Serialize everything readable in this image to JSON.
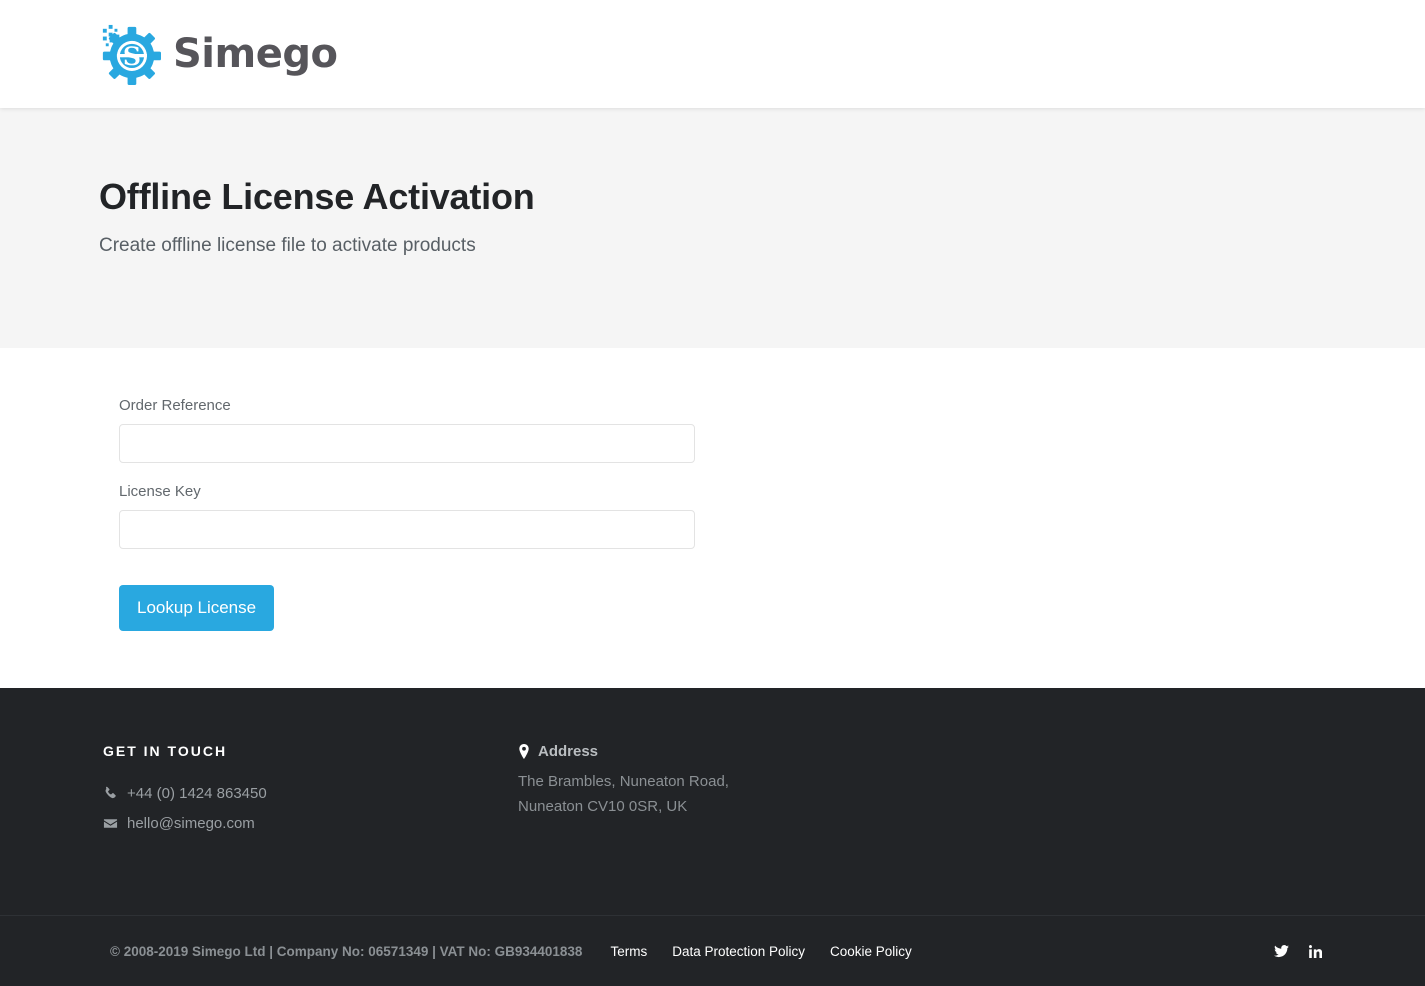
{
  "header": {
    "logo_text": "Simego",
    "logo_icon": "simego-gear-logo"
  },
  "hero": {
    "title": "Offline License Activation",
    "subtitle": "Create offline license file to activate products"
  },
  "form": {
    "order_reference": {
      "label": "Order Reference",
      "value": "",
      "placeholder": ""
    },
    "license_key": {
      "label": "License Key",
      "value": "",
      "placeholder": ""
    },
    "submit_label": "Lookup License",
    "accent_color": "#29a8e0"
  },
  "footer": {
    "background_color": "#222427",
    "get_in_touch": {
      "heading": "GET IN TOUCH",
      "phone": "+44 (0) 1424 863450",
      "phone_icon": "phone-icon",
      "email": "hello@simego.com",
      "email_icon": "envelope-icon"
    },
    "address": {
      "title": "Address",
      "title_icon": "map-pin-icon",
      "line1": "The Brambles, Nuneaton Road,",
      "line2": "Nuneaton CV10 0SR, UK"
    },
    "bottom": {
      "copyright": "© 2008-2019 Simego Ltd | Company No: 06571349 | VAT No: GB934401838",
      "links": [
        {
          "label": "Terms"
        },
        {
          "label": "Data Protection Policy"
        },
        {
          "label": "Cookie Policy"
        }
      ],
      "social": [
        {
          "name": "twitter-icon"
        },
        {
          "name": "linkedin-icon"
        }
      ]
    }
  }
}
